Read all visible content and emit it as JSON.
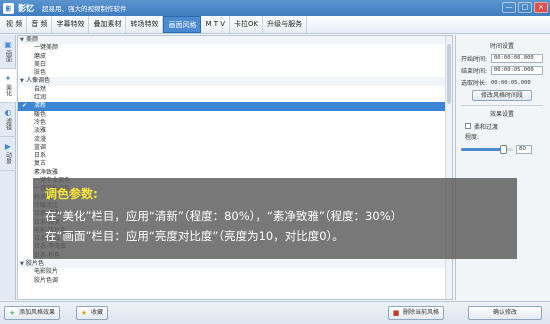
{
  "app": {
    "icon_glyph": "影",
    "name": "影忆",
    "slogan": "超易用、强大的视频制作软件",
    "window_buttons": [
      "—",
      "□",
      "×"
    ]
  },
  "menu": {
    "tabs": [
      "视 频",
      "音 频",
      "字幕特效",
      "叠加素材",
      "转场特效",
      "画面风格",
      "M T V",
      "卡拉OK",
      "升级与服务"
    ],
    "active_index": 5
  },
  "left_tabs": [
    {
      "label": "画面",
      "icon": "picture-icon"
    },
    {
      "label": "美化",
      "icon": "magic-wand-icon"
    },
    {
      "label": "滤镜",
      "icon": "filter-icon"
    },
    {
      "label": "动景",
      "icon": "motion-icon"
    }
  ],
  "left_active_index": 1,
  "style_list": {
    "groups": [
      {
        "name": "美颜",
        "items": [
          "一键美颜",
          "磨皮",
          "美白",
          "肤色"
        ]
      },
      {
        "name": "人像调色",
        "items": [
          "自然",
          "红润",
          "清新",
          "暖色",
          "冷色",
          "淡雅",
          "流漫",
          "蓝调",
          "日系",
          "复古",
          "素净致雅",
          "一键专业调色",
          "一键电影调色",
          "韩系胶片",
          "冷暖对比",
          "日系-青色",
          "日系-甜美",
          "电影-胶片色",
          "日系-柔白",
          "日系-甲壳虫",
          "日系-粉色"
        ]
      },
      {
        "name": "胶片色",
        "items": [
          "电影胶片",
          "胶片色调"
        ]
      }
    ],
    "selected_item": "清新",
    "colors": {
      "selected_bg": "#3e84d4",
      "group_bg": "#f1f4f8"
    }
  },
  "right_panel": {
    "time_section_title": "时间设置",
    "start_label": "开始时间:",
    "start_value": "00:00:00.000",
    "end_label": "结束时间:",
    "end_value": "00:00:05.000",
    "duration_label": "选取时长:",
    "duration_value": "00:00:05.000",
    "modify_time_button": "修改风格时间段",
    "effect_section_title": "效果设置",
    "fade_label": "柔和过渡",
    "degree_label": "程度:",
    "degree_value": "80",
    "degree_percent": 80
  },
  "bottom": {
    "add_style_button": "添加风格效果",
    "favorite_button": "收藏",
    "delete_style_button": "删除当前风格",
    "confirm_button": "确认修改"
  },
  "overlay": {
    "title": "调色参数:",
    "line1": "在“美化”栏目，应用“清新”（程度：80%），“素净致雅”（程度：30%）",
    "line2": "在“画面”栏目：应用“亮度对比度”（亮度为10，对比度0）。",
    "title_color": "#f5e23a"
  }
}
